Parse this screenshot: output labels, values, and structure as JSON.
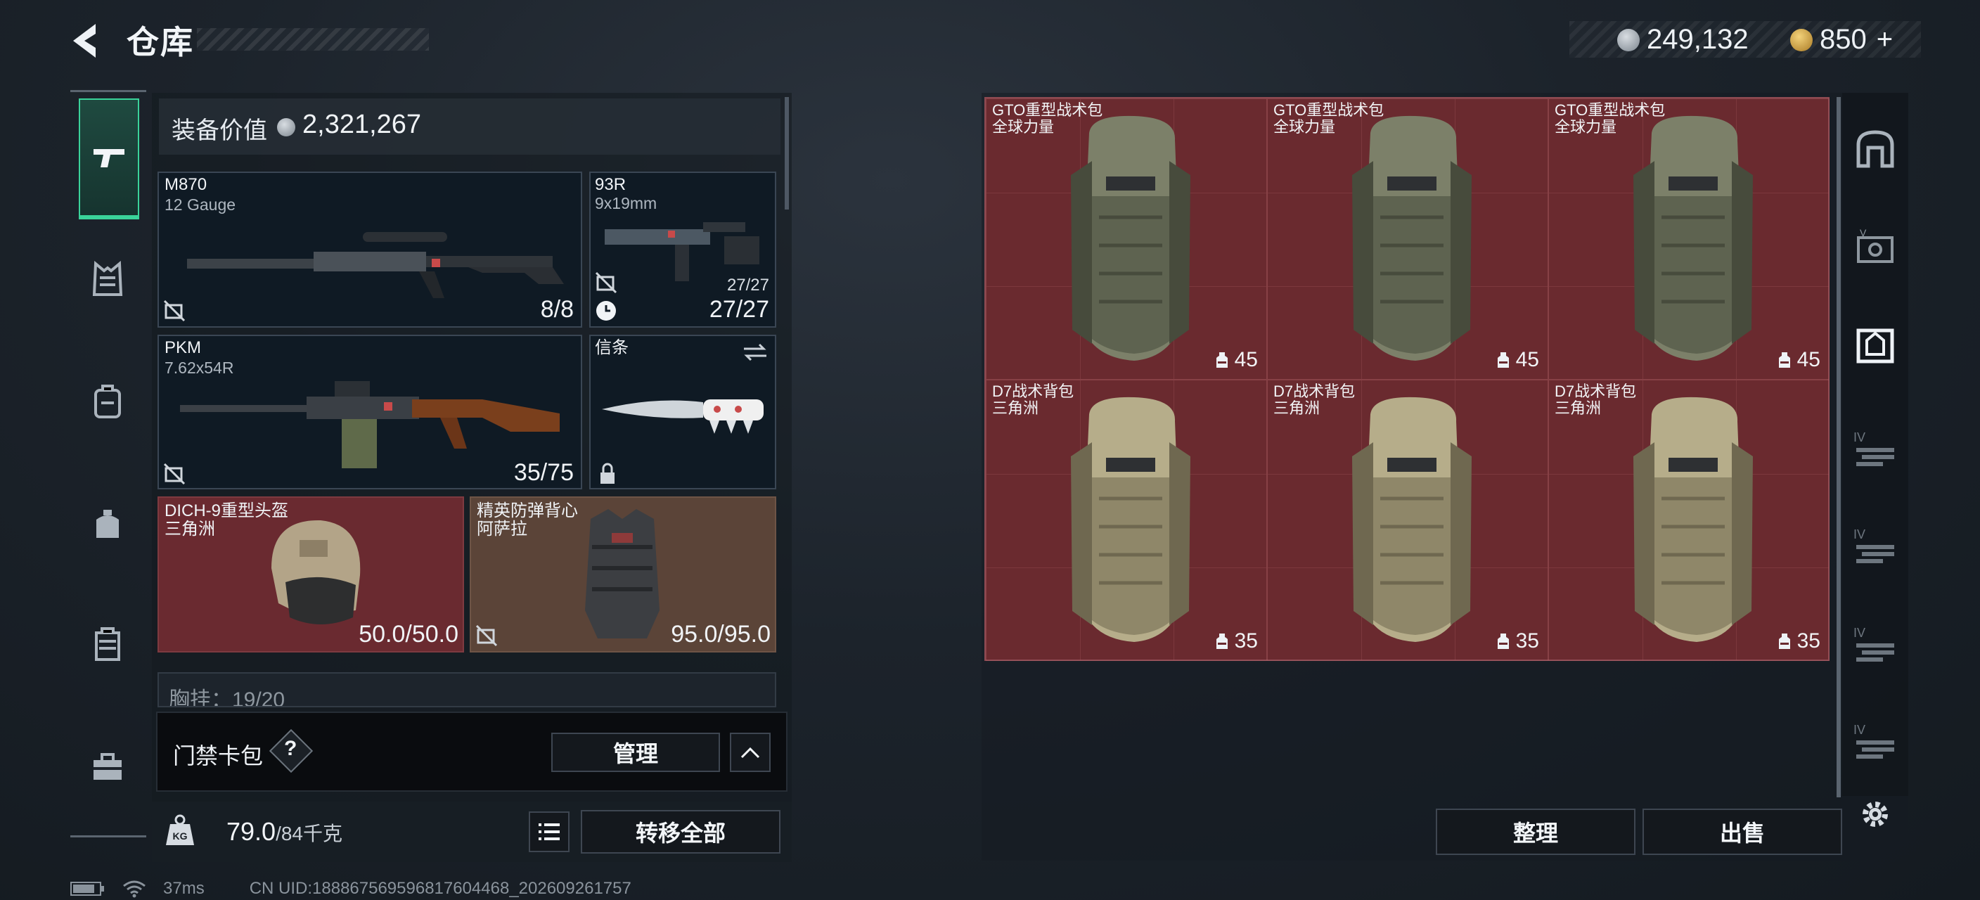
{
  "header": {
    "title": "仓库",
    "currency_primary": "249,132",
    "currency_secondary": "850",
    "add_symbol": "+"
  },
  "equipment": {
    "value_label": "装备价值",
    "value": "2,321,267",
    "slots": [
      {
        "name": "M870",
        "sub": "12 Gauge",
        "ammo": "8/8"
      },
      {
        "name": "93R",
        "sub": "9x19mm",
        "ammo_small": "27/27",
        "ammo": "27/27"
      },
      {
        "name": "PKM",
        "sub": "7.62x54R",
        "ammo": "35/75"
      },
      {
        "name": "信条",
        "sub": "",
        "ammo": ""
      },
      {
        "name": "DICH-9重型头盔",
        "sub": "三角洲",
        "durability": "50.0/50.0"
      },
      {
        "name": "精英防弹背心",
        "sub": "阿萨拉",
        "durability": "95.0/95.0"
      }
    ],
    "partial_row": "胸挂：19/20"
  },
  "keycard": {
    "label": "门禁卡包",
    "help": "?",
    "manage_label": "管理"
  },
  "weight": {
    "current": "79.0",
    "max": "/84千克"
  },
  "transfer_all_label": "转移全部",
  "inventory": {
    "items": [
      {
        "name": "GTO重型战术包",
        "sub": "全球力量",
        "capacity": "45"
      },
      {
        "name": "GTO重型战术包",
        "sub": "全球力量",
        "capacity": "45"
      },
      {
        "name": "GTO重型战术包",
        "sub": "全球力量",
        "capacity": "45"
      },
      {
        "name": "D7战术背包",
        "sub": "三角洲",
        "capacity": "35"
      },
      {
        "name": "D7战术背包",
        "sub": "三角洲",
        "capacity": "35"
      },
      {
        "name": "D7战术背包",
        "sub": "三角洲",
        "capacity": "35"
      }
    ],
    "sort_label": "整理",
    "sell_label": "出售"
  },
  "status": {
    "ping": "37ms",
    "uid": "CN UID:18886756959681760446​8_202609261757"
  },
  "colors": {
    "accent": "#3ad39a",
    "grid_red": "#6a2a2f",
    "slot_dark": "#0f1a24"
  }
}
